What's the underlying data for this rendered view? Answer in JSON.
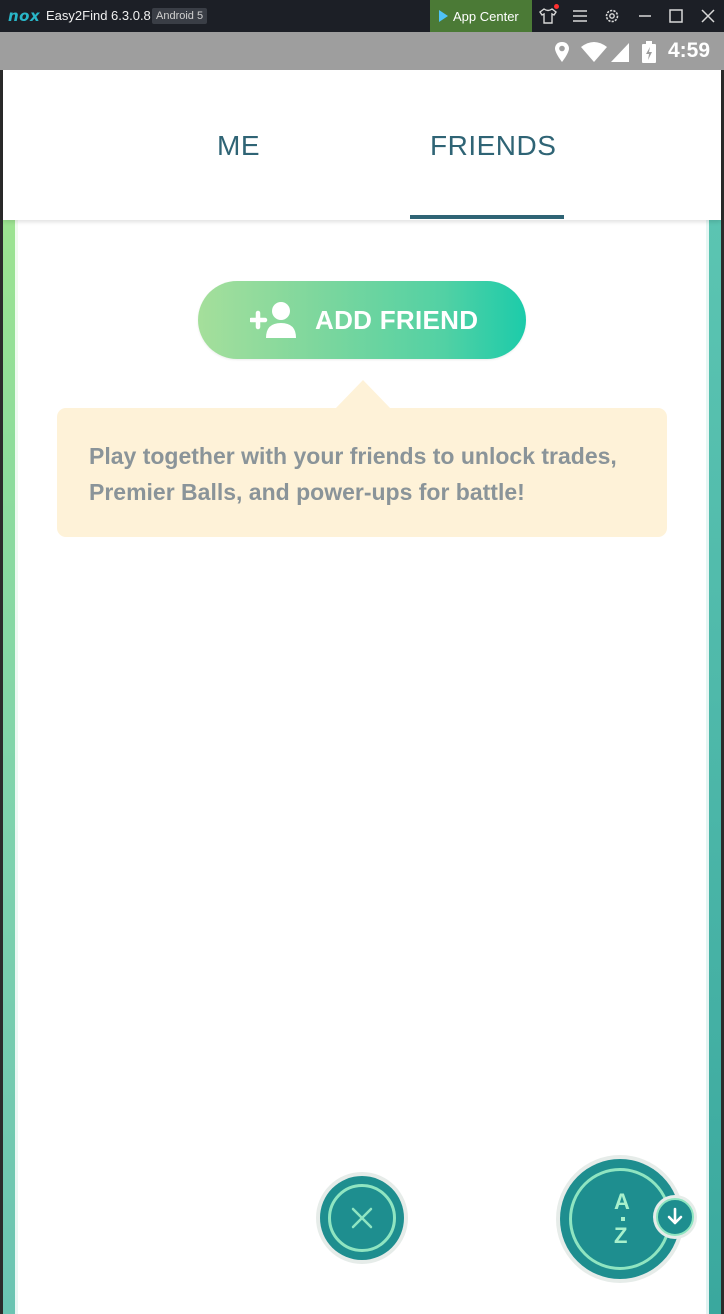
{
  "emulator": {
    "logo": "nox",
    "app_name": "Easy2Find 6.3.0.8",
    "android_badge": "Android 5",
    "app_center_label": "App Center",
    "icons": [
      "play-icon",
      "shirt-icon",
      "menu-icon",
      "settings-icon",
      "minimize-icon",
      "maximize-icon",
      "close-icon"
    ]
  },
  "status_bar": {
    "time": "4:59",
    "icons": [
      "location-icon",
      "wifi-icon",
      "signal-icon",
      "battery-icon"
    ]
  },
  "tabs": [
    {
      "label": "ME",
      "active": false
    },
    {
      "label": "FRIENDS",
      "active": true
    }
  ],
  "add_friend": {
    "label": "ADD FRIEND",
    "icon": "add-person-icon"
  },
  "tooltip": {
    "text": "Play together with your friends to unlock trades, Premier Balls, and power-ups for battle!"
  },
  "bottom_controls": {
    "close_icon": "close-x-icon",
    "sort_top": "A",
    "sort_bottom": "Z",
    "sort_direction_icon": "arrow-down-icon"
  },
  "colors": {
    "tab_text": "#2f6475",
    "button_gradient_start": "#a5df9b",
    "button_gradient_end": "#1ccbaa",
    "tooltip_bg": "#fef2d8",
    "tooltip_text": "#8a9499",
    "round_button_fill": "#1e8e8f",
    "round_button_ring": "#8fe5c1"
  }
}
